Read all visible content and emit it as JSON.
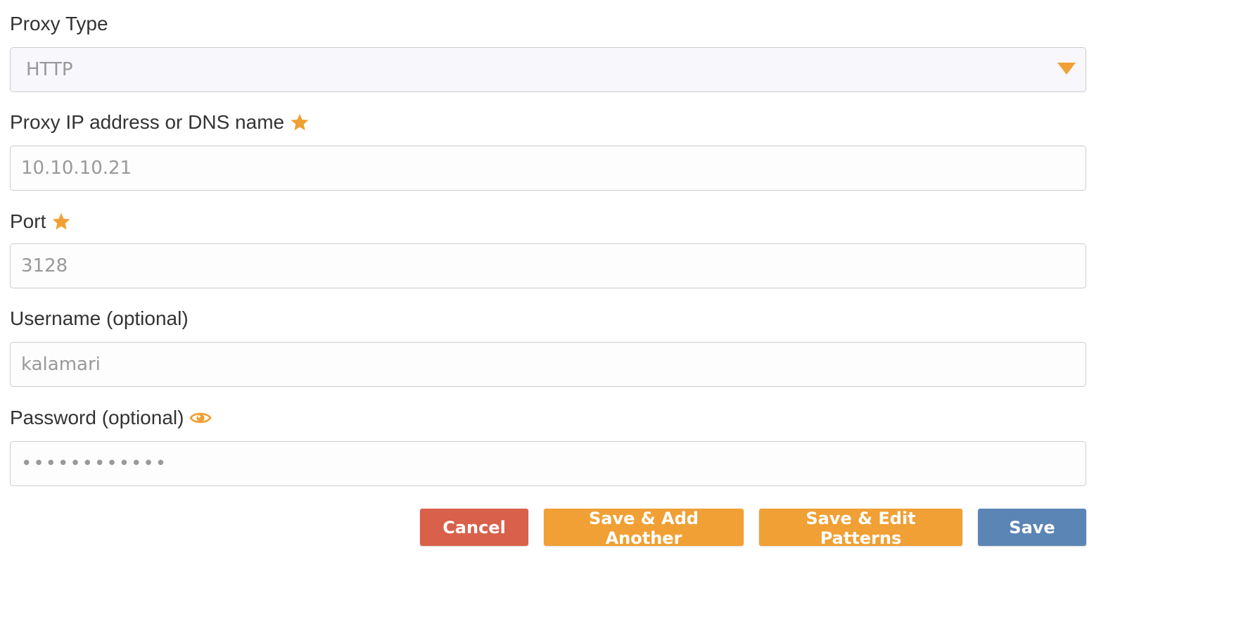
{
  "colors": {
    "accent": "#f0a034",
    "cancel": "#d9604a",
    "save": "#5b85b5",
    "label": "#333333",
    "value": "#999999"
  },
  "proxy_type": {
    "label": "Proxy Type",
    "selected": "HTTP",
    "caret_icon": "triangle-down-icon"
  },
  "proxy_host": {
    "label": "Proxy IP address or DNS name",
    "required_icon": "star-icon",
    "value": "10.10.10.21"
  },
  "port": {
    "label": "Port",
    "required_icon": "star-icon",
    "value": "3128"
  },
  "username": {
    "label": "Username (optional)",
    "value": "kalamari"
  },
  "password": {
    "label": "Password (optional)",
    "toggle_icon": "eye-icon",
    "value": "●●●●●●●●●●●●"
  },
  "buttons": {
    "cancel": "Cancel",
    "save_add_another": "Save & Add Another",
    "save_edit_patterns": "Save & Edit Patterns",
    "save": "Save"
  }
}
